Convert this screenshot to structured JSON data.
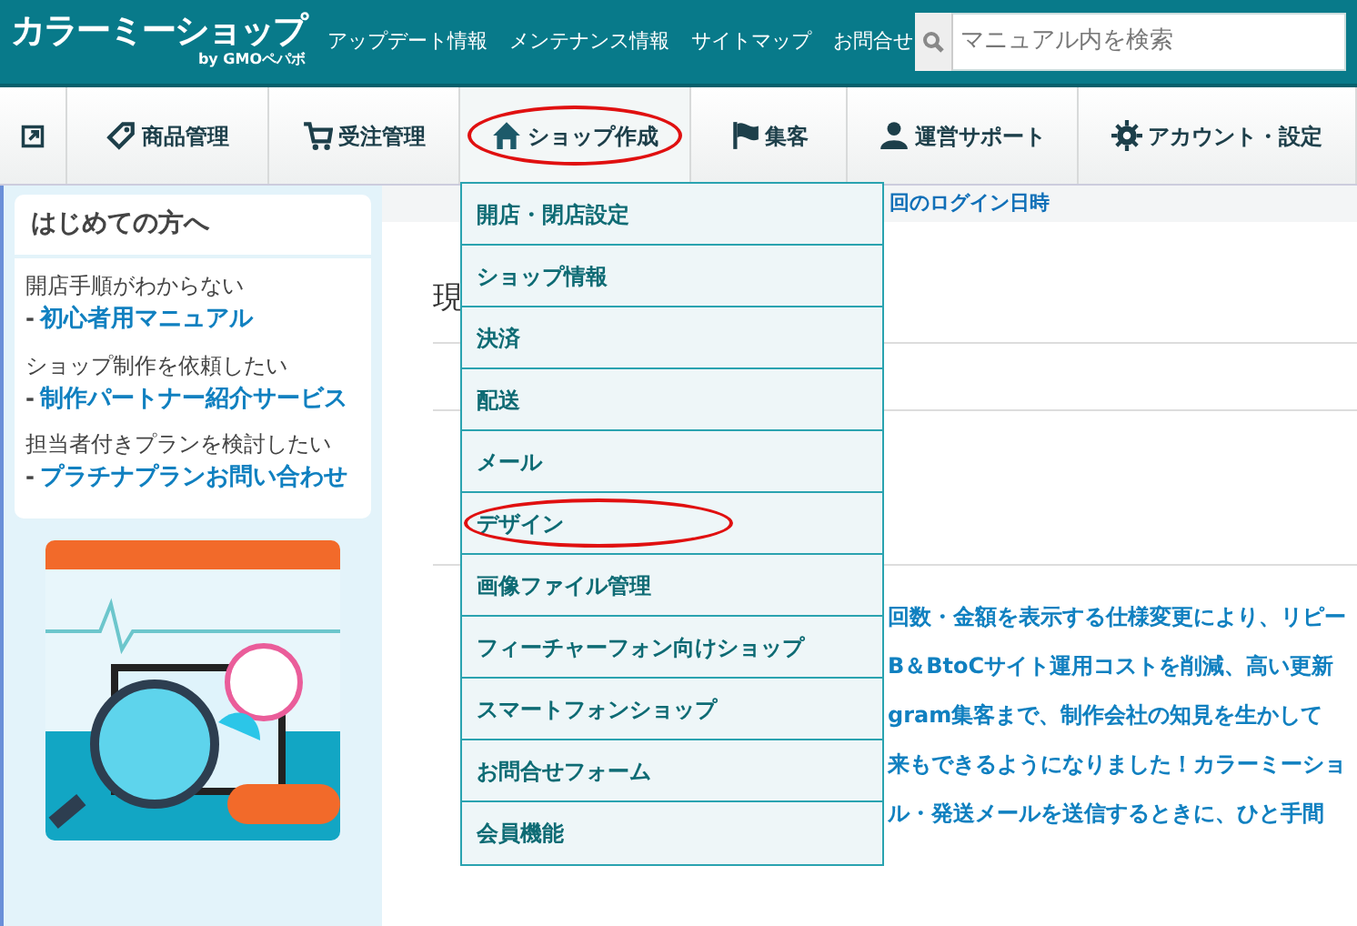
{
  "header": {
    "logo": "カラーミーショップ",
    "logo_sub": "by GMOペパボ",
    "links": [
      "アップデート情報",
      "メンテナンス情報",
      "サイトマップ",
      "お問合せ"
    ],
    "search": {
      "placeholder": "マニュアル内を検索"
    }
  },
  "nav": [
    {
      "selected": false,
      "circled": false
    },
    {
      "label": "商品管理",
      "selected": false,
      "circled": false
    },
    {
      "label": "受注管理",
      "selected": false,
      "circled": false
    },
    {
      "label": "ショップ作成",
      "selected": true,
      "circled": true
    },
    {
      "label": "集客",
      "selected": false,
      "circled": false
    },
    {
      "label": "運営サポート",
      "selected": false,
      "circled": false
    },
    {
      "label": "アカウント・設定",
      "selected": false,
      "circled": false
    }
  ],
  "dropdown": [
    {
      "label": "開店・閉店設定",
      "circled": false
    },
    {
      "label": "ショップ情報",
      "circled": false
    },
    {
      "label": "決済",
      "circled": false
    },
    {
      "label": "配送",
      "circled": false
    },
    {
      "label": "メール",
      "circled": false
    },
    {
      "label": "デザイン",
      "circled": true
    },
    {
      "label": "画像ファイル管理",
      "circled": false
    },
    {
      "label": "フィーチャーフォン向けショップ",
      "circled": false
    },
    {
      "label": "スマートフォンショップ",
      "circled": false
    },
    {
      "label": "お問合せフォーム",
      "circled": false
    },
    {
      "label": "会員機能",
      "circled": false
    }
  ],
  "sidebar": {
    "title": "はじめての方へ",
    "items": [
      {
        "note": "開店手順がわからない",
        "bullet": "-",
        "link": "初心者用マニュアル"
      },
      {
        "note": "ショップ制作を依頼したい",
        "bullet": "-",
        "link": "制作パートナー紹介サービス"
      },
      {
        "note": "担当者付きプランを検討したい",
        "bullet": "-",
        "link": "プラチナプランお問い合わせ"
      }
    ]
  },
  "content": {
    "login_strip": "回のログイン日時",
    "heading": "現",
    "news": [
      "回数・金額を表示する仕様変更により、リピー",
      "B＆BtoCサイト運用コストを削減、高い更新",
      "gram集客まで、制作会社の知見を生かして",
      "来もできるようになりました！カラーミーショ",
      "ル・発送メールを送信するときに、ひと手間"
    ]
  }
}
